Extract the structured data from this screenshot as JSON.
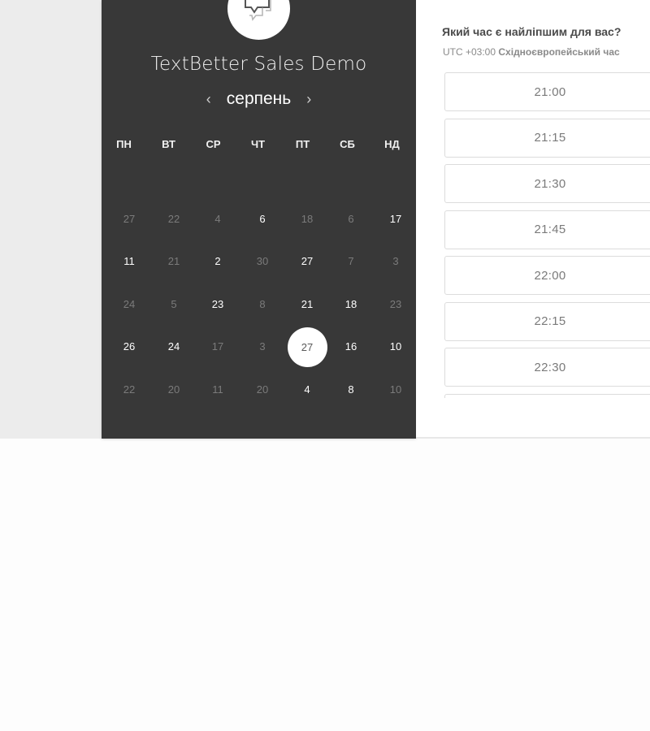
{
  "scheduler": {
    "title": "TextBetter Sales Demo",
    "month": "серпень",
    "prev_icon": "chevron-left-icon",
    "next_icon": "chevron-right-icon",
    "logo_icon": "chat-bubbles-icon",
    "weekdays": [
      "ПН",
      "ВТ",
      "СР",
      "ЧТ",
      "ПТ",
      "СБ",
      "НД"
    ],
    "weeks": [
      [
        {
          "d": "27",
          "a": false
        },
        {
          "d": "22",
          "a": false
        },
        {
          "d": "4",
          "a": false
        },
        {
          "d": "6",
          "a": true
        },
        {
          "d": "18",
          "a": false
        },
        {
          "d": "6",
          "a": false
        },
        {
          "d": "17",
          "a": true
        }
      ],
      [
        {
          "d": "11",
          "a": true
        },
        {
          "d": "21",
          "a": false
        },
        {
          "d": "2",
          "a": true
        },
        {
          "d": "30",
          "a": false
        },
        {
          "d": "27",
          "a": true
        },
        {
          "d": "7",
          "a": false
        },
        {
          "d": "3",
          "a": false
        }
      ],
      [
        {
          "d": "24",
          "a": false
        },
        {
          "d": "5",
          "a": false
        },
        {
          "d": "23",
          "a": true
        },
        {
          "d": "8",
          "a": false
        },
        {
          "d": "21",
          "a": true
        },
        {
          "d": "18",
          "a": true
        },
        {
          "d": "23",
          "a": false
        }
      ],
      [
        {
          "d": "26",
          "a": true
        },
        {
          "d": "24",
          "a": true
        },
        {
          "d": "17",
          "a": false
        },
        {
          "d": "3",
          "a": false
        },
        {
          "d": "27",
          "a": true,
          "selected": true
        },
        {
          "d": "16",
          "a": true
        },
        {
          "d": "10",
          "a": true
        }
      ],
      [
        {
          "d": "22",
          "a": false
        },
        {
          "d": "20",
          "a": false
        },
        {
          "d": "11",
          "a": false
        },
        {
          "d": "20",
          "a": false
        },
        {
          "d": "4",
          "a": true
        },
        {
          "d": "8",
          "a": true
        },
        {
          "d": "10",
          "a": false
        }
      ]
    ]
  },
  "times": {
    "question": "Який час є найліпшим для вас?",
    "tz_offset": "UTC +03:00",
    "tz_name": "Східноєвропейський час",
    "slots": [
      "21:00",
      "21:15",
      "21:30",
      "21:45",
      "22:00",
      "22:15",
      "22:30",
      ""
    ]
  },
  "colors": {
    "panel": "#383838",
    "selected_bg": "#ffffff",
    "inactive_day": "#7b7b7b"
  }
}
